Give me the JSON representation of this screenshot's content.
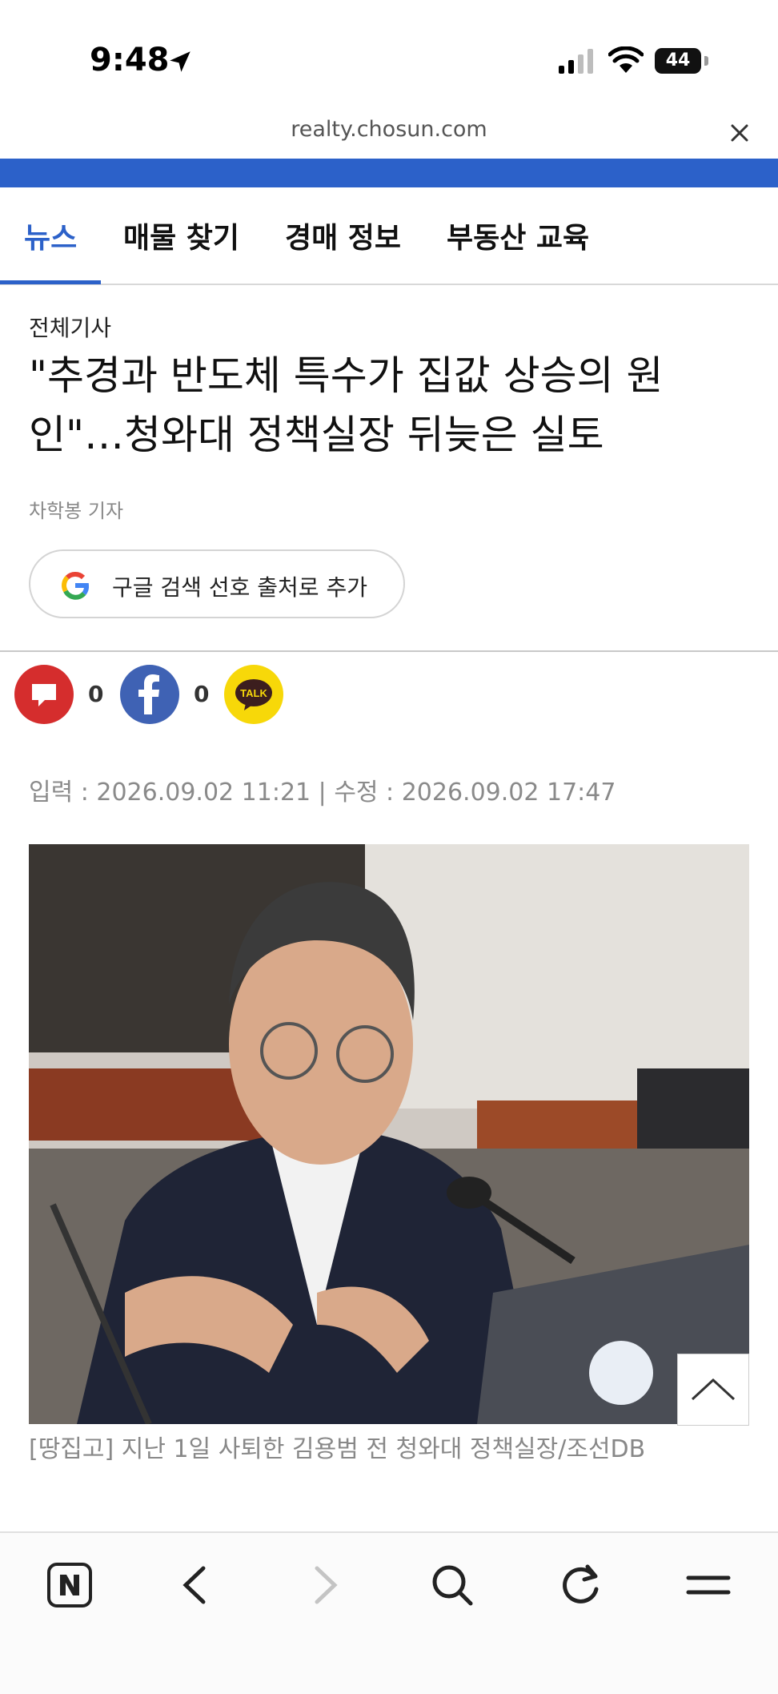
{
  "status_bar": {
    "time": "9:48",
    "battery": "44"
  },
  "browser": {
    "url": "realty.chosun.com"
  },
  "nav": {
    "tabs": [
      "뉴스",
      "매물 찾기",
      "경매 정보",
      "부동산 교육"
    ],
    "active_tab": "뉴스"
  },
  "article": {
    "category": "전체기사",
    "headline_line1": "\"추경과 반도체 특수가 집값 상승의 원",
    "headline_line2": "인\"…청와대 정책실장 뒤늦은 실토",
    "byline": "차학봉 기자",
    "google_button_label": "구글 검색 선호 출처로 추가",
    "comment_count": "0",
    "facebook_count": "0",
    "kakao_label": "TALK",
    "dates": "입력 : 2026.09.02 11:21 | 수정 : 2026.09.02 17:47",
    "caption": "[땅집고] 지난 1일 사퇴한 김용범 전 청와대 정책실장/조선DB"
  },
  "colors": {
    "accent": "#2c61c9",
    "comment": "#d52d2d",
    "facebook": "#3f62b4",
    "kakao": "#f7d809"
  },
  "icons": {
    "status": [
      "location-arrow-icon",
      "signal-icon",
      "wifi-icon",
      "battery-icon"
    ],
    "toolbar": [
      "naver-n-icon",
      "back-arrow-icon",
      "forward-arrow-icon",
      "search-icon",
      "refresh-icon",
      "menu-icon"
    ]
  }
}
